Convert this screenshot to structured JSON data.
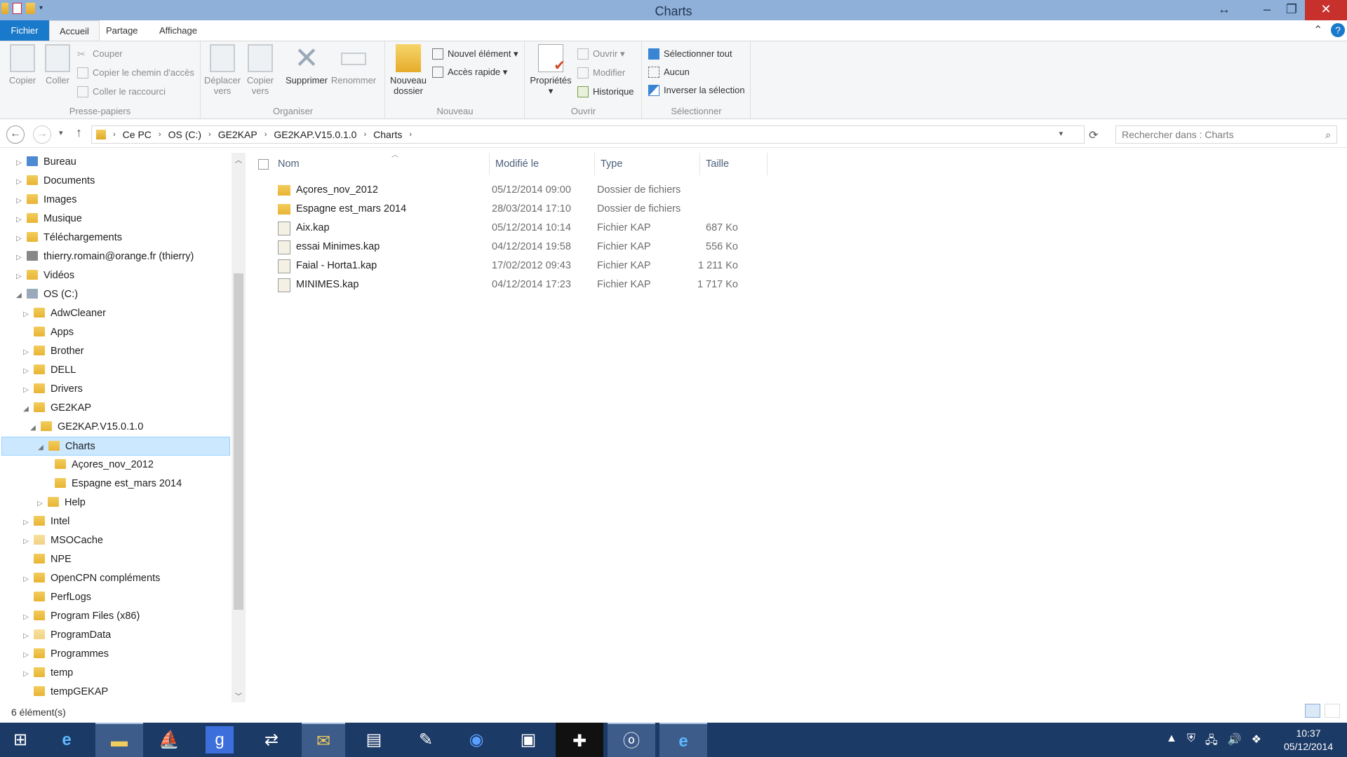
{
  "window": {
    "title": "Charts"
  },
  "ribbon_tabs": [
    {
      "label": "Fichier"
    },
    {
      "label": "Accueil"
    },
    {
      "label": "Partage"
    },
    {
      "label": "Affichage"
    }
  ],
  "ribbon": {
    "presse_papiers": {
      "group_label": "Presse-papiers",
      "copier": "Copier",
      "coller": "Coller",
      "couper": "Couper",
      "copier_chemin": "Copier le chemin d'accès",
      "coller_raccourci": "Coller le raccourci"
    },
    "organiser": {
      "group_label": "Organiser",
      "deplacer_1": "Déplacer",
      "deplacer_2": "vers",
      "copier_1": "Copier",
      "copier_2": "vers",
      "supprimer": "Supprimer",
      "renommer": "Renommer"
    },
    "nouveau": {
      "group_label": "Nouveau",
      "nouveau_dossier_1": "Nouveau",
      "nouveau_dossier_2": "dossier",
      "nouvel_element": "Nouvel élément",
      "acces_rapide": "Accès rapide"
    },
    "ouvrir": {
      "group_label": "Ouvrir",
      "proprietes": "Propriétés",
      "ouvrir": "Ouvrir",
      "modifier": "Modifier",
      "historique": "Historique"
    },
    "selectionner": {
      "group_label": "Sélectionner",
      "tout": "Sélectionner tout",
      "aucun": "Aucun",
      "inverser": "Inverser la sélection"
    }
  },
  "address": {
    "crumbs": [
      "Ce PC",
      "OS (C:)",
      "GE2KAP",
      "GE2KAP.V15.0.1.0",
      "Charts"
    ],
    "search_placeholder": "Rechercher dans : Charts"
  },
  "tree": [
    {
      "label": "Bureau"
    },
    {
      "label": "Documents"
    },
    {
      "label": "Images"
    },
    {
      "label": "Musique"
    },
    {
      "label": "Téléchargements"
    },
    {
      "label": "thierry.romain@orange.fr (thierry)"
    },
    {
      "label": "Vidéos"
    },
    {
      "label": "OS (C:)"
    },
    {
      "label": "AdwCleaner"
    },
    {
      "label": "Apps"
    },
    {
      "label": "Brother"
    },
    {
      "label": "DELL"
    },
    {
      "label": "Drivers"
    },
    {
      "label": "GE2KAP"
    },
    {
      "label": "GE2KAP.V15.0.1.0"
    },
    {
      "label": "Charts"
    },
    {
      "label": "Açores_nov_2012"
    },
    {
      "label": "Espagne est_mars 2014"
    },
    {
      "label": "Help"
    },
    {
      "label": "Intel"
    },
    {
      "label": "MSOCache"
    },
    {
      "label": "NPE"
    },
    {
      "label": "OpenCPN compléments"
    },
    {
      "label": "PerfLogs"
    },
    {
      "label": "Program Files (x86)"
    },
    {
      "label": "ProgramData"
    },
    {
      "label": "Programmes"
    },
    {
      "label": "temp"
    },
    {
      "label": "tempGEKAP"
    }
  ],
  "columns": {
    "name": "Nom",
    "modified": "Modifié le",
    "type": "Type",
    "size": "Taille"
  },
  "files": [
    {
      "name": "Açores_nov_2012",
      "modified": "05/12/2014 09:00",
      "type": "Dossier de fichiers",
      "size": ""
    },
    {
      "name": "Espagne est_mars 2014",
      "modified": "28/03/2014 17:10",
      "type": "Dossier de fichiers",
      "size": ""
    },
    {
      "name": "Aix.kap",
      "modified": "05/12/2014 10:14",
      "type": "Fichier KAP",
      "size": "687 Ko"
    },
    {
      "name": "essai Minimes.kap",
      "modified": "04/12/2014 19:58",
      "type": "Fichier KAP",
      "size": "556 Ko"
    },
    {
      "name": "Faial - Horta1.kap",
      "modified": "17/02/2012 09:43",
      "type": "Fichier KAP",
      "size": "1 211 Ko"
    },
    {
      "name": "MINIMES.kap",
      "modified": "04/12/2014 17:23",
      "type": "Fichier KAP",
      "size": "1 717 Ko"
    }
  ],
  "status": {
    "count": "6 élément(s)"
  },
  "taskbar": {
    "time": "10:37",
    "date": "05/12/2014"
  }
}
